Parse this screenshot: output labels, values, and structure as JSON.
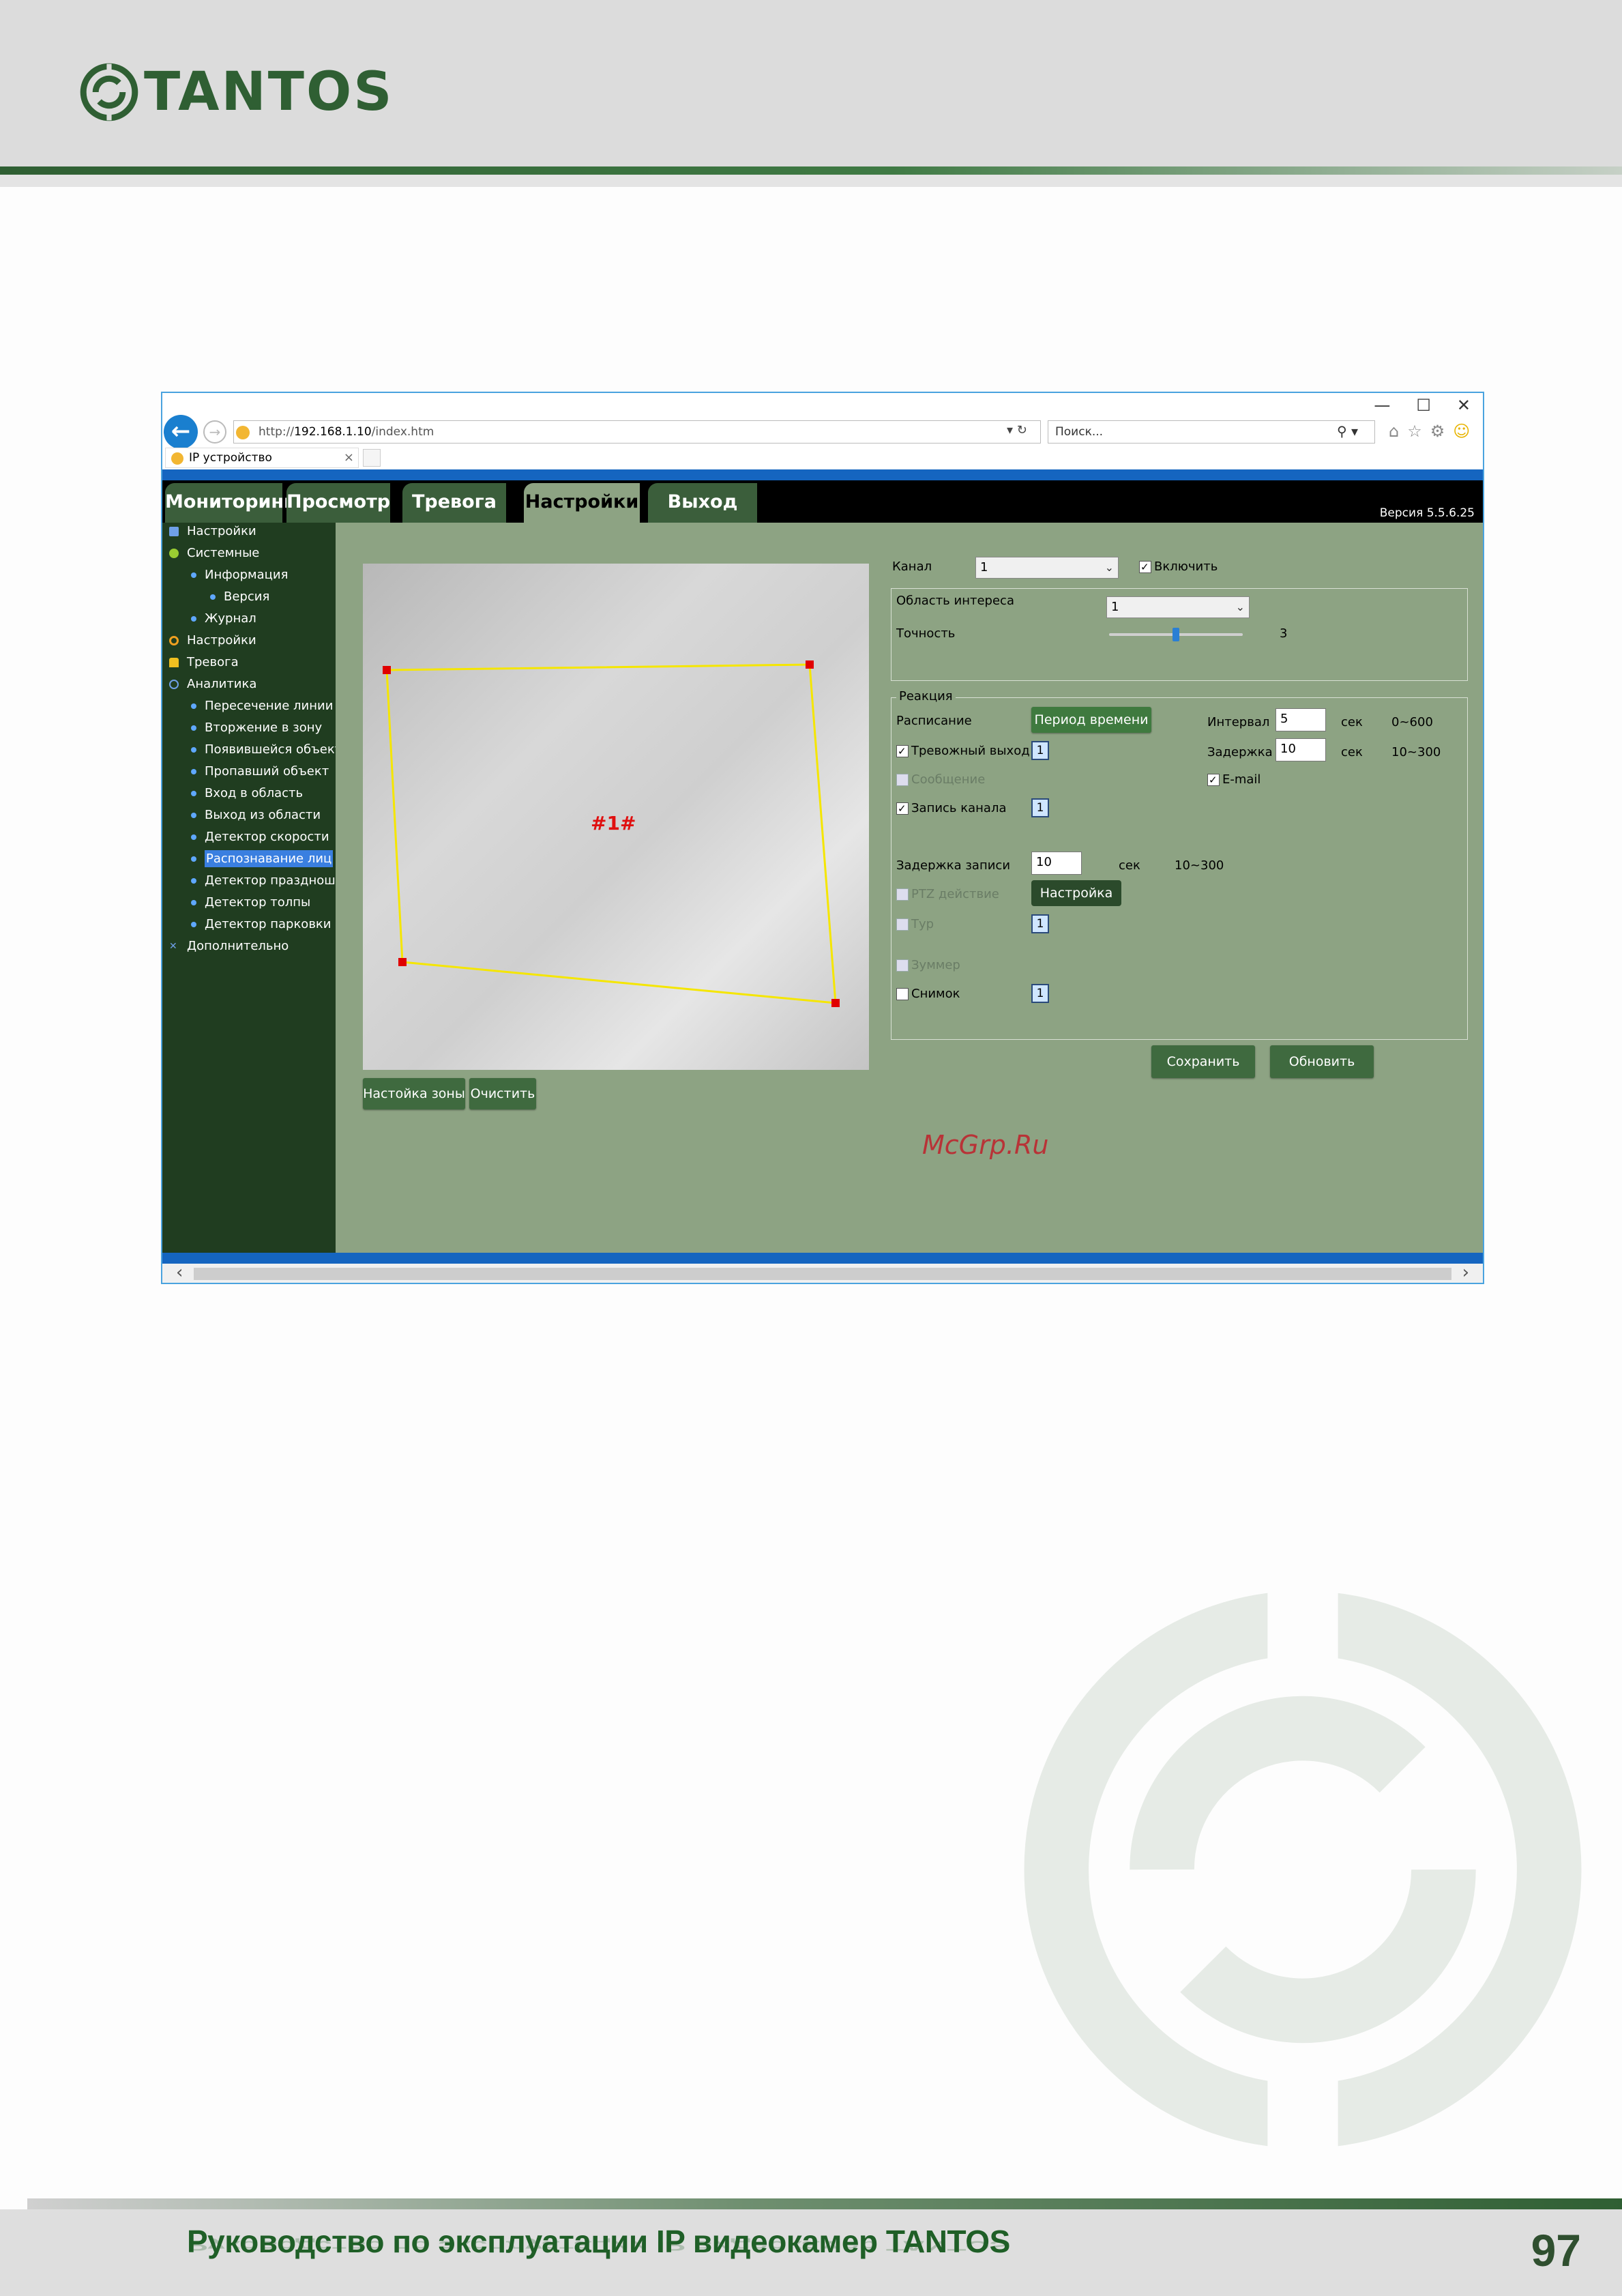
{
  "header": {
    "logo_text": "TANTOS"
  },
  "browser": {
    "url_prefix": "http://",
    "url_host": "192.168.1.10",
    "url_path": "/index.htm",
    "search_placeholder": "Поиск...",
    "tab_title": "IP устройство",
    "win_min": "—",
    "win_max": "☐",
    "win_close": "✕"
  },
  "nav": {
    "tabs": [
      {
        "label": "Мониторинг"
      },
      {
        "label": "Просмотр"
      },
      {
        "label": "Тревога"
      },
      {
        "label": "Настройки"
      },
      {
        "label": "Выход"
      }
    ],
    "active": "Настройки",
    "version": "Версия 5.5.6.25"
  },
  "sidebar": {
    "items": [
      {
        "label": "Настройки"
      },
      {
        "label": "Системные"
      },
      {
        "label": "Информация"
      },
      {
        "label": "Версия"
      },
      {
        "label": "Журнал"
      },
      {
        "label": "Настройки"
      },
      {
        "label": "Тревога"
      },
      {
        "label": "Аналитика"
      },
      {
        "label": "Пересечение линии"
      },
      {
        "label": "Вторжение в зону"
      },
      {
        "label": "Появившейся объект"
      },
      {
        "label": "Пропавший объект"
      },
      {
        "label": "Вход в область"
      },
      {
        "label": "Выход из области"
      },
      {
        "label": "Детектор скорости"
      },
      {
        "label": "Распознавание лиц"
      },
      {
        "label": "Детектор праздноша"
      },
      {
        "label": "Детектор толпы"
      },
      {
        "label": "Детектор парковки"
      },
      {
        "label": "Дополнительно"
      }
    ],
    "selected": "Распознавание лиц"
  },
  "video": {
    "zone_label": "#1#",
    "zone_button": "Настойка зоны",
    "clear_button": "Очистить"
  },
  "form": {
    "channel_label": "Канал",
    "channel_value": "1",
    "enable_label": "Включить",
    "enable_checked": true,
    "roi_label": "Область интереса",
    "roi_value": "1",
    "accuracy_label": "Точность",
    "accuracy_value": "3",
    "accuracy_fraction": 0.5,
    "reaction_legend": "Реакция",
    "schedule_label": "Расписание",
    "schedule_button": "Период времени",
    "interval_label": "Интервал",
    "interval_value": "5",
    "interval_unit": "сек",
    "interval_range": "0~600",
    "alarm_out_label": "Тревожный выход",
    "alarm_out_num": "1",
    "delay_label": "Задержка ...",
    "delay_value": "10",
    "delay_unit": "сек",
    "delay_range": "10~300",
    "message_label": "Сообщение",
    "email_label": "E-mail",
    "record_label": "Запись канала",
    "record_num": "1",
    "record_delay_label": "Задержка записи",
    "record_delay_value": "10",
    "record_delay_unit": "сек",
    "record_delay_range": "10~300",
    "ptz_label": "PTZ действие",
    "ptz_button": "Настройка",
    "tour_label": "Тур",
    "tour_num": "1",
    "buzzer_label": "Зуммер",
    "snapshot_label": "Снимок",
    "snapshot_num": "1",
    "save_button": "Сохранить",
    "refresh_button": "Обновить"
  },
  "watermark": "McGrp.Ru",
  "footer": {
    "title": "Руководство по эксплуатации IP видеокамер TANTOS",
    "page_number": "97"
  },
  "colors": {
    "brand_green": "#2f5f33",
    "nav_active": "#8da383",
    "sidebar_bg": "#203d20",
    "zone_line": "#f5e600",
    "zone_point": "#e00000"
  }
}
